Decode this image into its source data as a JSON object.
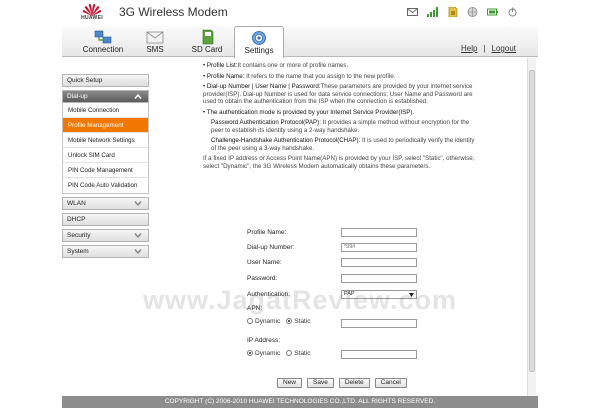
{
  "header": {
    "brand": "HUAWEI",
    "title": "3G Wireless Modem",
    "status_icons": [
      "mail-icon",
      "signal-icon",
      "sim-icon",
      "globe-icon",
      "battery-icon",
      "power-icon"
    ]
  },
  "nav": {
    "tabs": [
      {
        "label": "Connection",
        "icon": "connection-icon"
      },
      {
        "label": "SMS",
        "icon": "sms-icon"
      },
      {
        "label": "SD Card",
        "icon": "sd-card-icon"
      },
      {
        "label": "Settings",
        "icon": "settings-gear-icon",
        "active": true
      }
    ],
    "help_label": "Help",
    "separator": "|",
    "logout_label": "Logout"
  },
  "sidebar": {
    "quick_setup": "Quick Setup",
    "dialup": "Dial-up",
    "dialup_items": [
      "Mobile Connection",
      "Profile Management",
      "Mobile Network Settings",
      "Unlock SIM Card",
      "PIN Code Management",
      "PIN Code Auto Validation"
    ],
    "active_item": "Profile Management",
    "wlan": "WLAN",
    "dhcp": "DHCP",
    "security": "Security",
    "system": "System"
  },
  "help": {
    "p1_term": "Profile List:",
    "p1_text": "It contains one or more of profile names.",
    "p2_term": "Profile Name:",
    "p2_text": " It refers to the name that you assign to the new profile.",
    "p3_term": "Dial-up Number | User Name | Password:",
    "p3_text": "These parameters are provided by your internet service provider(ISP). Dial-up Number is used for data service connections; User Name and Password are used to obtain the authentication from the ISP when the connection is established.",
    "p4_text": "The authentication mode is provided by your Internet Service Provider(ISP).",
    "p5_term": "Password Authentication Protocol(PAP):",
    "p5_text": " It provides a simple method without encryption for the peer to establish its identity using a 2-way handshake.",
    "p6_term": "Challenge-Handshake Authentication Protocol(CHAP):",
    "p6_text": " It is used to periodically verify the identity of the peer using a 3-way handshake.",
    "p7_text": "If a fixed IP address or Access Point Name(APN) is provided by your ISP, select \"Static\", otherwise, select \"Dynamic\", the 3G Wireless Modem automatically obtains these parameters."
  },
  "form": {
    "profile_name_label": "Profile Name:",
    "profile_name_value": "",
    "dialup_number_label": "Dial-up Number:",
    "dialup_number_value": "*99#",
    "user_name_label": "User Name:",
    "password_label": "Password:",
    "authentication_label": "Authentication:",
    "authentication_value": "PAP",
    "apn_label": "APN:",
    "apn_dynamic": "Dynamic",
    "apn_static": "Static",
    "apn_selected": "Static",
    "ip_label": "IP Address:",
    "ip_dynamic": "Dynamic",
    "ip_static": "Static",
    "ip_selected": "Dynamic"
  },
  "buttons": {
    "new": "New",
    "save": "Save",
    "delete": "Delete",
    "cancel": "Cancel"
  },
  "watermark": "www.JagatReview.com",
  "footer": "COPYRIGHT (C) 2006-2010 HUAWEI TECHNOLOGIES CO.,LTD. ALL RIGHTS RESERVED.",
  "colors": {
    "accent_orange": "#f07800",
    "footer_gray": "#8d8d8d",
    "active_section": "#6e6e6e"
  }
}
